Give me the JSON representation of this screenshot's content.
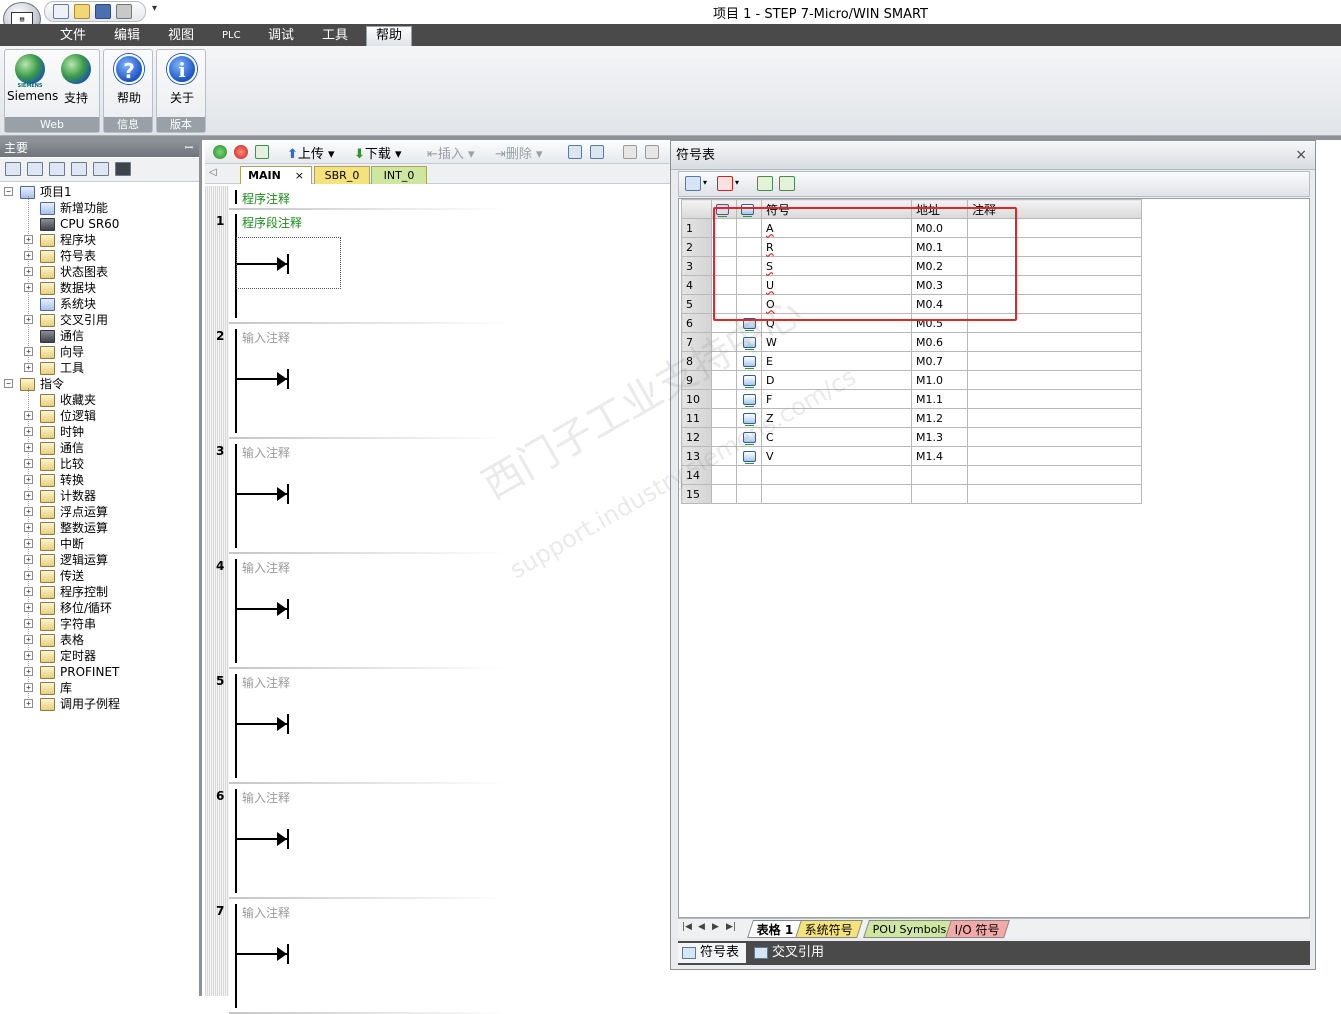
{
  "window": {
    "title": "项目 1 - STEP 7-Micro/WIN SMART"
  },
  "menu": [
    "文件",
    "编辑",
    "视图",
    "PLC",
    "调试",
    "工具",
    "帮助"
  ],
  "ribbon": {
    "groups": [
      {
        "label": "Web",
        "buttons": [
          "Siemens",
          "支持"
        ]
      },
      {
        "label": "信息",
        "buttons": [
          "帮助"
        ]
      },
      {
        "label": "版本",
        "buttons": [
          "关于"
        ]
      }
    ],
    "siemens_logo_text": "SIEMENS"
  },
  "left_panel": {
    "title": "主要",
    "pin": "ꟷ",
    "project_tree": [
      {
        "label": "项目1",
        "icon": "project-icon"
      },
      {
        "label": "新增功能",
        "icon": "whats-new-icon"
      },
      {
        "label": "CPU SR60",
        "icon": "cpu-icon"
      },
      {
        "label": "程序块",
        "icon": "program-block-icon"
      },
      {
        "label": "符号表",
        "icon": "symbol-table-icon"
      },
      {
        "label": "状态图表",
        "icon": "status-chart-icon"
      },
      {
        "label": "数据块",
        "icon": "data-block-icon"
      },
      {
        "label": "系统块",
        "icon": "system-block-icon"
      },
      {
        "label": "交叉引用",
        "icon": "cross-reference-icon"
      },
      {
        "label": "通信",
        "icon": "communication-icon"
      },
      {
        "label": "向导",
        "icon": "wizard-icon"
      },
      {
        "label": "工具",
        "icon": "tools-icon"
      }
    ],
    "instructions_root": "指令",
    "instructions": [
      "收藏夹",
      "位逻辑",
      "时钟",
      "通信",
      "比较",
      "转换",
      "计数器",
      "浮点运算",
      "整数运算",
      "中断",
      "逻辑运算",
      "传送",
      "程序控制",
      "移位/循环",
      "字符串",
      "表格",
      "定时器",
      "PROFINET",
      "库",
      "调用子例程"
    ]
  },
  "editor": {
    "toolbar": {
      "upload": "上传",
      "download": "下载",
      "insert": "插入",
      "delete": "删除"
    },
    "tabs": [
      "MAIN",
      "SBR_0",
      "INT_0"
    ],
    "tab_close": "×",
    "program_comment": "程序注释",
    "networks": [
      {
        "num": "1",
        "comment": "程序段注释"
      },
      {
        "num": "2",
        "comment": "输入注释"
      },
      {
        "num": "3",
        "comment": "输入注释"
      },
      {
        "num": "4",
        "comment": "输入注释"
      },
      {
        "num": "5",
        "comment": "输入注释"
      },
      {
        "num": "6",
        "comment": "输入注释"
      },
      {
        "num": "7",
        "comment": "输入注释"
      }
    ]
  },
  "symbol_table": {
    "title": "符号表",
    "close": "×",
    "columns": [
      "符号",
      "地址",
      "注释"
    ],
    "rows": [
      {
        "n": "1",
        "symbol": "A",
        "address": "M0.0",
        "comment": "",
        "icon": false,
        "error": true
      },
      {
        "n": "2",
        "symbol": "R",
        "address": "M0.1",
        "comment": "",
        "icon": false,
        "error": true
      },
      {
        "n": "3",
        "symbol": "S",
        "address": "M0.2",
        "comment": "",
        "icon": false,
        "error": true
      },
      {
        "n": "4",
        "symbol": "U",
        "address": "M0.3",
        "comment": "",
        "icon": false,
        "error": true
      },
      {
        "n": "5",
        "symbol": "O",
        "address": "M0.4",
        "comment": "",
        "icon": false,
        "error": true
      },
      {
        "n": "6",
        "symbol": "Q",
        "address": "M0.5",
        "comment": "",
        "icon": true,
        "error": false
      },
      {
        "n": "7",
        "symbol": "W",
        "address": "M0.6",
        "comment": "",
        "icon": true,
        "error": false
      },
      {
        "n": "8",
        "symbol": "E",
        "address": "M0.7",
        "comment": "",
        "icon": true,
        "error": false
      },
      {
        "n": "9",
        "symbol": "D",
        "address": "M1.0",
        "comment": "",
        "icon": true,
        "error": false
      },
      {
        "n": "10",
        "symbol": "F",
        "address": "M1.1",
        "comment": "",
        "icon": true,
        "error": false
      },
      {
        "n": "11",
        "symbol": "Z",
        "address": "M1.2",
        "comment": "",
        "icon": true,
        "error": false
      },
      {
        "n": "12",
        "symbol": "C",
        "address": "M1.3",
        "comment": "",
        "icon": true,
        "error": false
      },
      {
        "n": "13",
        "symbol": "V",
        "address": "M1.4",
        "comment": "",
        "icon": true,
        "error": false
      },
      {
        "n": "14",
        "symbol": "",
        "address": "",
        "comment": "",
        "icon": false,
        "error": false
      },
      {
        "n": "15",
        "symbol": "",
        "address": "",
        "comment": "",
        "icon": false,
        "error": false
      }
    ],
    "sheet_tabs": [
      {
        "label": "表格 1",
        "color": "#ffffff"
      },
      {
        "label": "系统符号",
        "color": "#f4e27a"
      },
      {
        "label": "POU Symbols",
        "color": "#cfe6a0"
      },
      {
        "label": "I/O 符号",
        "color": "#f4a8a8"
      }
    ],
    "bottom_tabs": [
      "符号表",
      "交叉引用"
    ]
  },
  "watermark": {
    "line1": "西门子工业支持中心",
    "line2": "support.industry.siemens.com/cs"
  },
  "colors": {
    "menubar": "#4a4a4a",
    "highlight": "#e0262a",
    "comment_green": "#1a8a1a"
  }
}
